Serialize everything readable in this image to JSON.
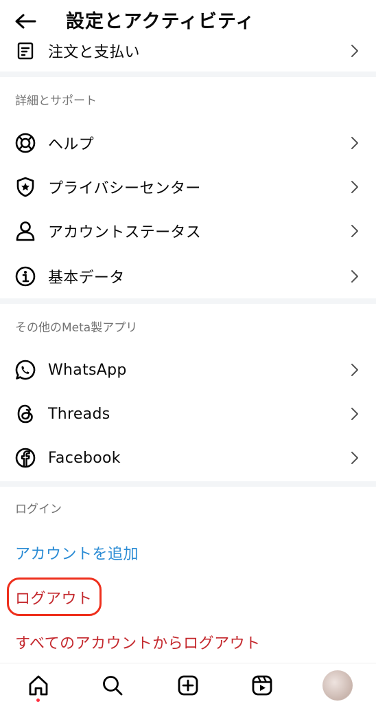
{
  "header": {
    "title": "設定とアクティビティ"
  },
  "orders": {
    "label": "注文と支払い"
  },
  "support": {
    "heading": "詳細とサポート",
    "items": [
      {
        "label": "ヘルプ",
        "icon": "lifebuoy-icon"
      },
      {
        "label": "プライバシーセンター",
        "icon": "shield-star-icon"
      },
      {
        "label": "アカウントステータス",
        "icon": "person-icon"
      },
      {
        "label": "基本データ",
        "icon": "info-icon"
      }
    ]
  },
  "meta_apps": {
    "heading": "その他のMeta製アプリ",
    "items": [
      {
        "label": "WhatsApp",
        "icon": "whatsapp-icon"
      },
      {
        "label": "Threads",
        "icon": "threads-icon"
      },
      {
        "label": "Facebook",
        "icon": "facebook-icon"
      }
    ]
  },
  "login": {
    "heading": "ログイン",
    "add_account": "アカウントを追加",
    "logout": "ログアウト",
    "logout_all": "すべてのアカウントからログアウト"
  },
  "colors": {
    "link_blue": "#2a8bd4",
    "link_red": "#c4282d",
    "highlight": "#ee2f1c",
    "notify_dot": "#ff3040"
  },
  "bottom_nav": [
    "home-icon",
    "search-icon",
    "create-icon",
    "reels-icon",
    "profile-avatar"
  ]
}
